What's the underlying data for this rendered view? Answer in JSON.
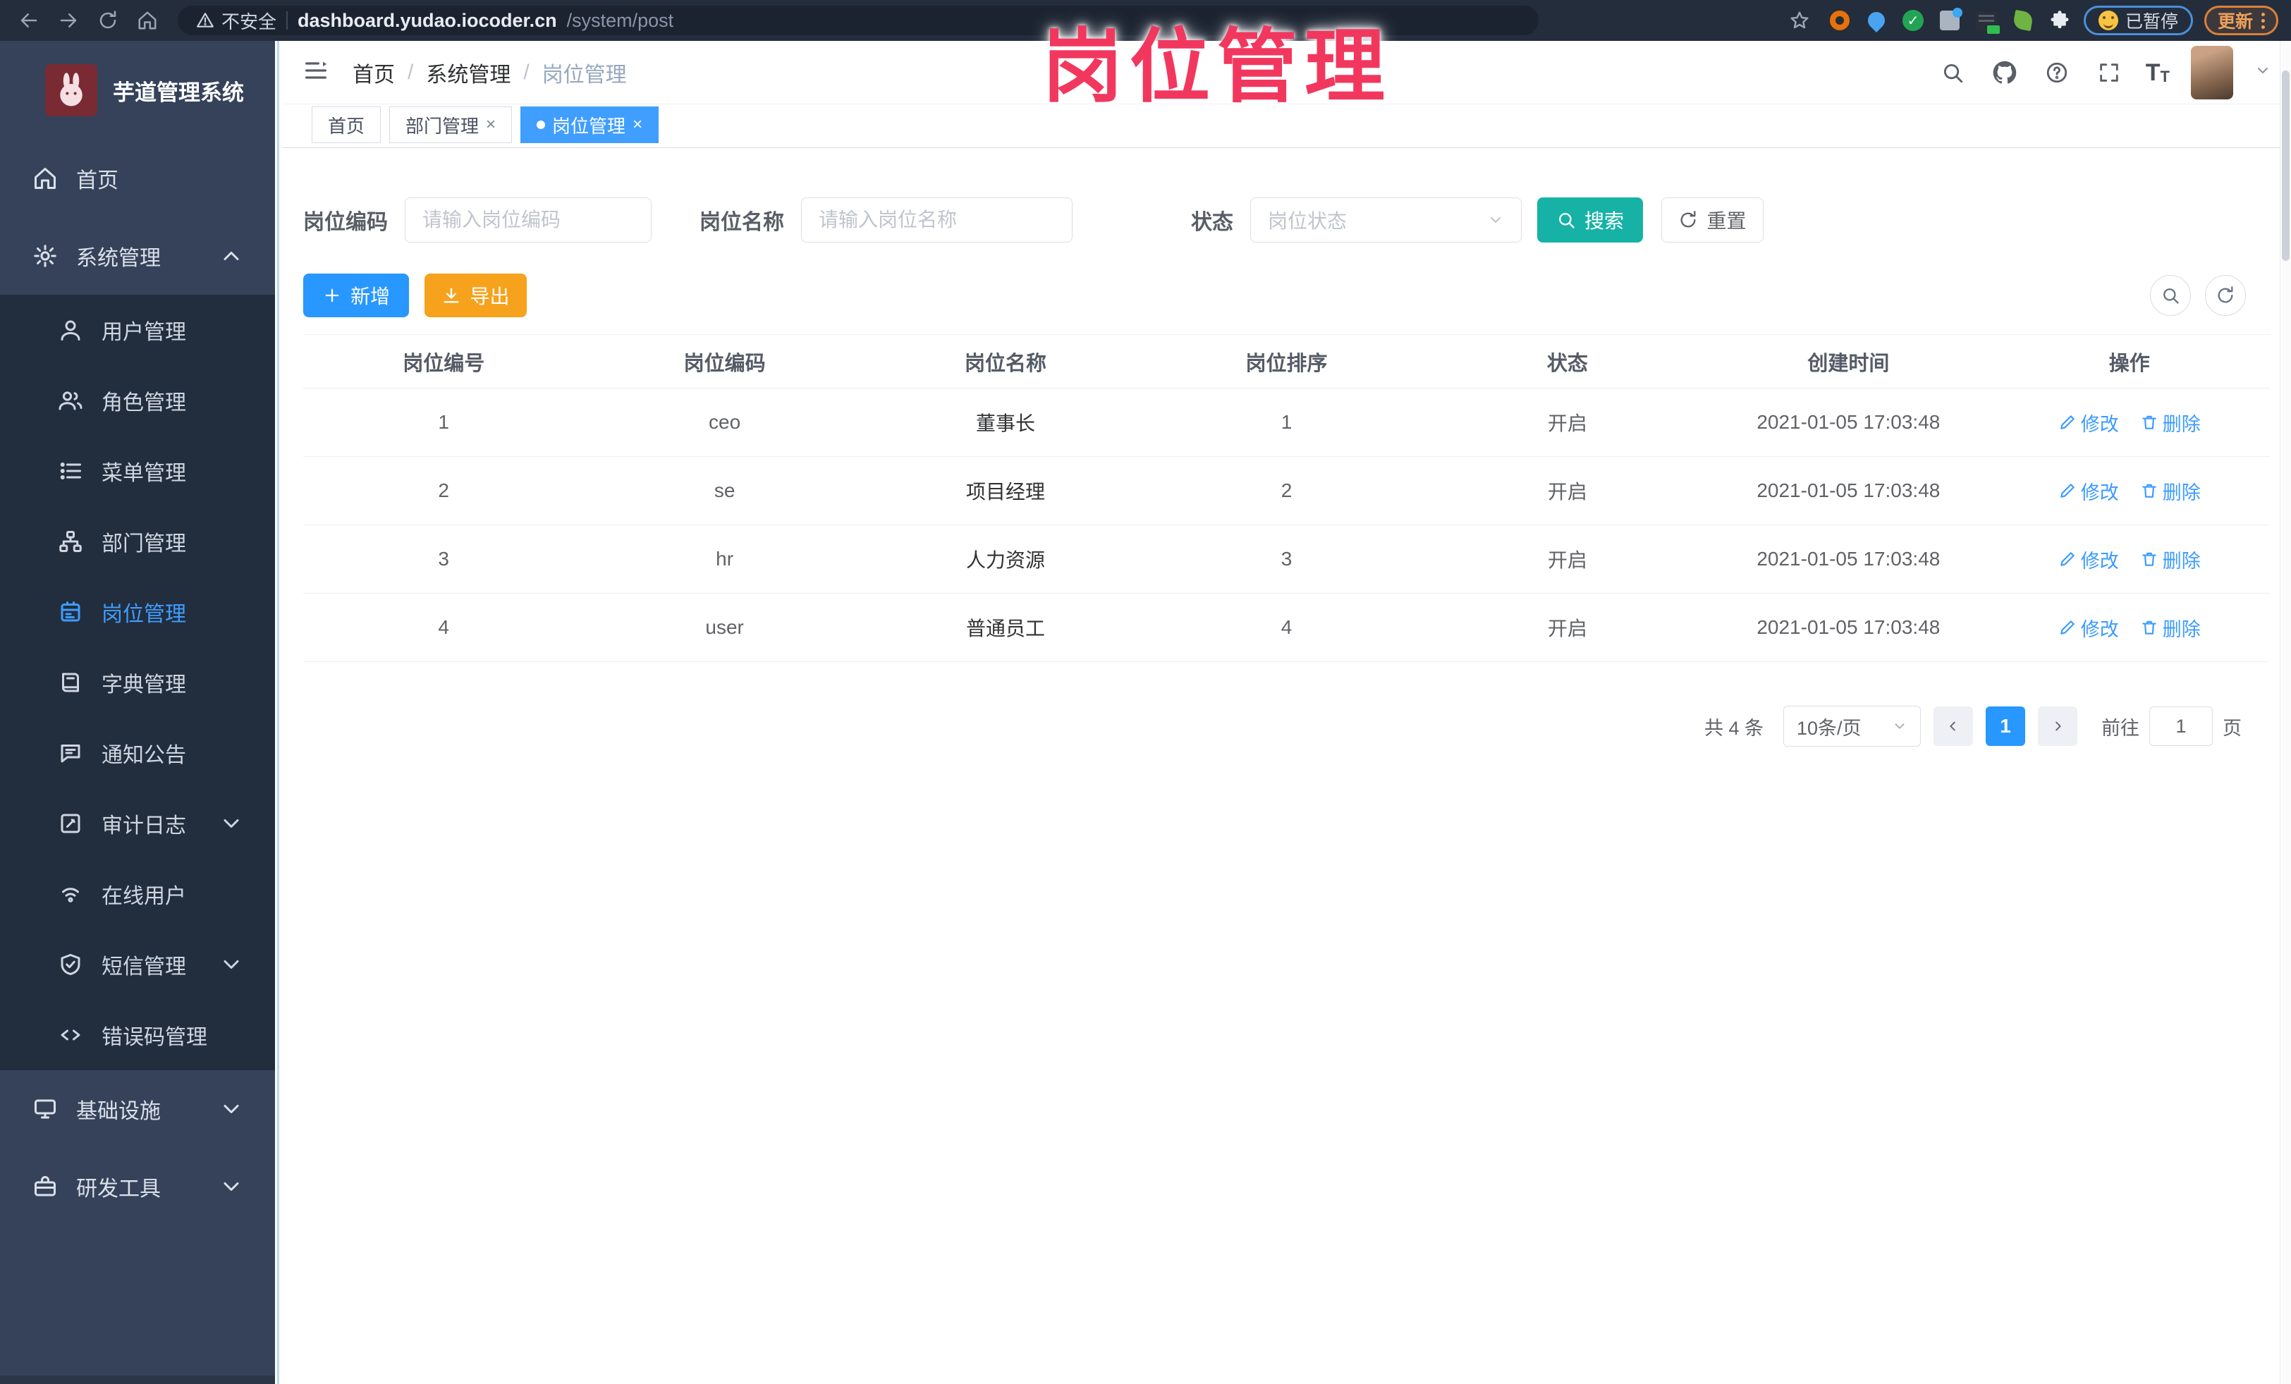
{
  "browser": {
    "security_label": "不安全",
    "url_host": "dashboard.yudao.iocoder.cn",
    "url_path": "/system/post",
    "paused_label": "已暂停",
    "update_label": "更新"
  },
  "watermark": "岗位管理",
  "sidebar": {
    "title": "芋道管理系统",
    "home": {
      "label": "首页"
    },
    "system": {
      "label": "系统管理"
    },
    "system_children": [
      {
        "label": "用户管理"
      },
      {
        "label": "角色管理"
      },
      {
        "label": "菜单管理"
      },
      {
        "label": "部门管理"
      },
      {
        "label": "岗位管理"
      },
      {
        "label": "字典管理"
      },
      {
        "label": "通知公告"
      },
      {
        "label": "审计日志"
      },
      {
        "label": "在线用户"
      },
      {
        "label": "短信管理"
      },
      {
        "label": "错误码管理"
      }
    ],
    "infra": {
      "label": "基础设施"
    },
    "tools": {
      "label": "研发工具"
    }
  },
  "breadcrumb": {
    "separator": "/",
    "items": [
      "首页",
      "系统管理",
      "岗位管理"
    ]
  },
  "tabs": {
    "items": [
      {
        "label": "首页"
      },
      {
        "label": "部门管理"
      },
      {
        "label": "岗位管理"
      }
    ],
    "close_glyph": "×"
  },
  "filters": {
    "code_label": "岗位编码",
    "code_placeholder": "请输入岗位编码",
    "name_label": "岗位名称",
    "name_placeholder": "请输入岗位名称",
    "status_label": "状态",
    "status_placeholder": "岗位状态",
    "search_label": "搜索",
    "reset_label": "重置"
  },
  "toolbar": {
    "add_label": "新增",
    "export_label": "导出"
  },
  "table": {
    "headers": [
      "岗位编号",
      "岗位编码",
      "岗位名称",
      "岗位排序",
      "状态",
      "创建时间",
      "操作"
    ],
    "edit_label": "修改",
    "delete_label": "删除",
    "rows": [
      {
        "id": "1",
        "code": "ceo",
        "name": "董事长",
        "sort": "1",
        "status": "开启",
        "created": "2021-01-05 17:03:48"
      },
      {
        "id": "2",
        "code": "se",
        "name": "项目经理",
        "sort": "2",
        "status": "开启",
        "created": "2021-01-05 17:03:48"
      },
      {
        "id": "3",
        "code": "hr",
        "name": "人力资源",
        "sort": "3",
        "status": "开启",
        "created": "2021-01-05 17:03:48"
      },
      {
        "id": "4",
        "code": "user",
        "name": "普通员工",
        "sort": "4",
        "status": "开启",
        "created": "2021-01-05 17:03:48"
      }
    ]
  },
  "pagination": {
    "total_label": "共 4 条",
    "page_size": "10条/页",
    "current_page": "1",
    "goto_label": "前往",
    "goto_value": "1",
    "page_suffix": "页"
  },
  "colors": {
    "accent_blue": "#409eff",
    "search_teal": "#17b2a6",
    "export_orange": "#f6a21c",
    "annotation_pink": "#f2375e",
    "sidebar_bg": "#36425a",
    "submenu_bg": "#222d3d"
  }
}
